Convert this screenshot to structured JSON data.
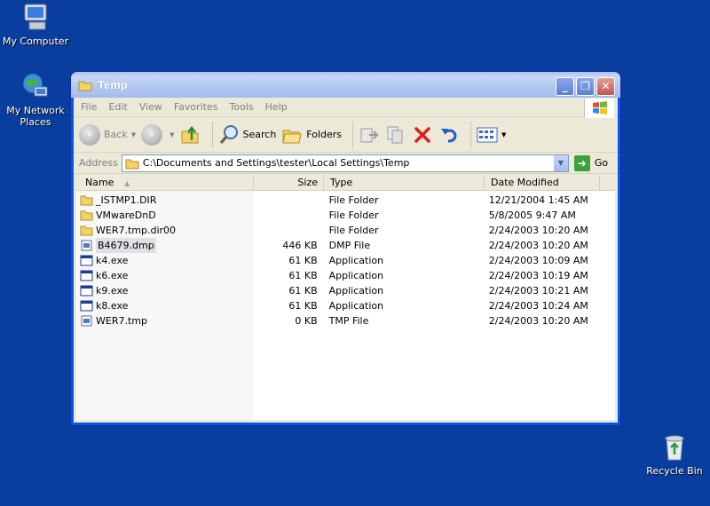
{
  "desktop": {
    "icons": [
      {
        "label": "My Computer"
      },
      {
        "label": "My Network Places"
      },
      {
        "label": "Recycle Bin"
      }
    ]
  },
  "window": {
    "title": "Temp",
    "menu": [
      "File",
      "Edit",
      "View",
      "Favorites",
      "Tools",
      "Help"
    ],
    "toolbar": {
      "back_label": "Back",
      "search_label": "Search",
      "folders_label": "Folders"
    },
    "address": {
      "label": "Address",
      "value": "C:\\Documents and Settings\\tester\\Local Settings\\Temp",
      "go_label": "Go"
    },
    "columns": {
      "name": "Name",
      "size": "Size",
      "type": "Type",
      "date": "Date Modified"
    },
    "files": [
      {
        "name": "_ISTMP1.DIR",
        "size": "",
        "type": "File Folder",
        "date": "12/21/2004 1:45 AM",
        "icon": "folder-icon"
      },
      {
        "name": "VMwareDnD",
        "size": "",
        "type": "File Folder",
        "date": "5/8/2005 9:47 AM",
        "icon": "folder-icon"
      },
      {
        "name": "WER7.tmp.dir00",
        "size": "",
        "type": "File Folder",
        "date": "2/24/2003 10:20 AM",
        "icon": "folder-icon"
      },
      {
        "name": "B4679.dmp",
        "size": "446 KB",
        "type": "DMP File",
        "date": "2/24/2003 10:20 AM",
        "icon": "file-icon"
      },
      {
        "name": "k4.exe",
        "size": "61 KB",
        "type": "Application",
        "date": "2/24/2003 10:09 AM",
        "icon": "app-icon"
      },
      {
        "name": "k6.exe",
        "size": "61 KB",
        "type": "Application",
        "date": "2/24/2003 10:19 AM",
        "icon": "app-icon"
      },
      {
        "name": "k9.exe",
        "size": "61 KB",
        "type": "Application",
        "date": "2/24/2003 10:21 AM",
        "icon": "app-icon"
      },
      {
        "name": "k8.exe",
        "size": "61 KB",
        "type": "Application",
        "date": "2/24/2003 10:24 AM",
        "icon": "app-icon"
      },
      {
        "name": "WER7.tmp",
        "size": "0 KB",
        "type": "TMP File",
        "date": "2/24/2003 10:20 AM",
        "icon": "file-icon"
      }
    ]
  },
  "colors": {
    "desktop": "#0a3e9e",
    "window_border": "#0a55e4",
    "chrome": "#ece9d8"
  }
}
